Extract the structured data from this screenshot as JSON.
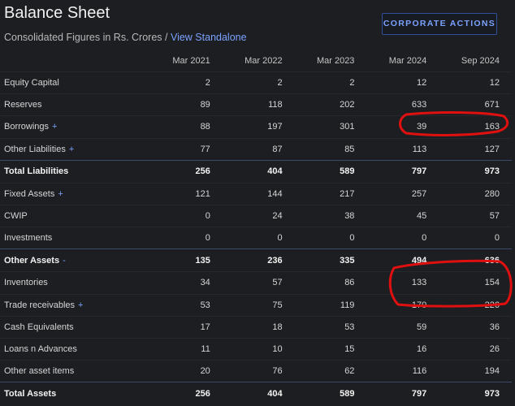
{
  "header": {
    "title": "Balance Sheet",
    "subtitle": "Consolidated Figures in Rs. Crores /",
    "link": "View Standalone",
    "button": "CORPORATE ACTIONS"
  },
  "columns": [
    "Mar 2021",
    "Mar 2022",
    "Mar 2023",
    "Mar 2024",
    "Sep 2024"
  ],
  "rows": [
    {
      "label": "Equity Capital",
      "values": [
        "2",
        "2",
        "2",
        "12",
        "12"
      ]
    },
    {
      "label": "Reserves",
      "values": [
        "89",
        "118",
        "202",
        "633",
        "671"
      ]
    },
    {
      "label": "Borrowings",
      "marker": "+",
      "values": [
        "88",
        "197",
        "301",
        "39",
        "163"
      ]
    },
    {
      "label": "Other Liabilities",
      "marker": "+",
      "values": [
        "77",
        "87",
        "85",
        "113",
        "127"
      ]
    },
    {
      "label": "Total Liabilities",
      "values": [
        "256",
        "404",
        "589",
        "797",
        "973"
      ]
    },
    {
      "label": "Fixed Assets",
      "marker": "+",
      "values": [
        "121",
        "144",
        "217",
        "257",
        "280"
      ]
    },
    {
      "label": "CWIP",
      "values": [
        "0",
        "24",
        "38",
        "45",
        "57"
      ]
    },
    {
      "label": "Investments",
      "values": [
        "0",
        "0",
        "0",
        "0",
        "0"
      ]
    },
    {
      "label": "Other Assets",
      "marker": "-",
      "values": [
        "135",
        "236",
        "335",
        "494",
        "636"
      ]
    },
    {
      "label": "Inventories",
      "values": [
        "34",
        "57",
        "86",
        "133",
        "154"
      ]
    },
    {
      "label": "Trade receivables",
      "marker": "+",
      "values": [
        "53",
        "75",
        "119",
        "170",
        "226"
      ]
    },
    {
      "label": "Cash Equivalents",
      "values": [
        "17",
        "18",
        "53",
        "59",
        "36"
      ]
    },
    {
      "label": "Loans n Advances",
      "values": [
        "11",
        "10",
        "15",
        "16",
        "26"
      ]
    },
    {
      "label": "Other asset items",
      "values": [
        "20",
        "76",
        "62",
        "116",
        "194"
      ]
    },
    {
      "label": "Total Assets",
      "values": [
        "256",
        "404",
        "589",
        "797",
        "973"
      ]
    }
  ],
  "annotation_color": "#e01010"
}
